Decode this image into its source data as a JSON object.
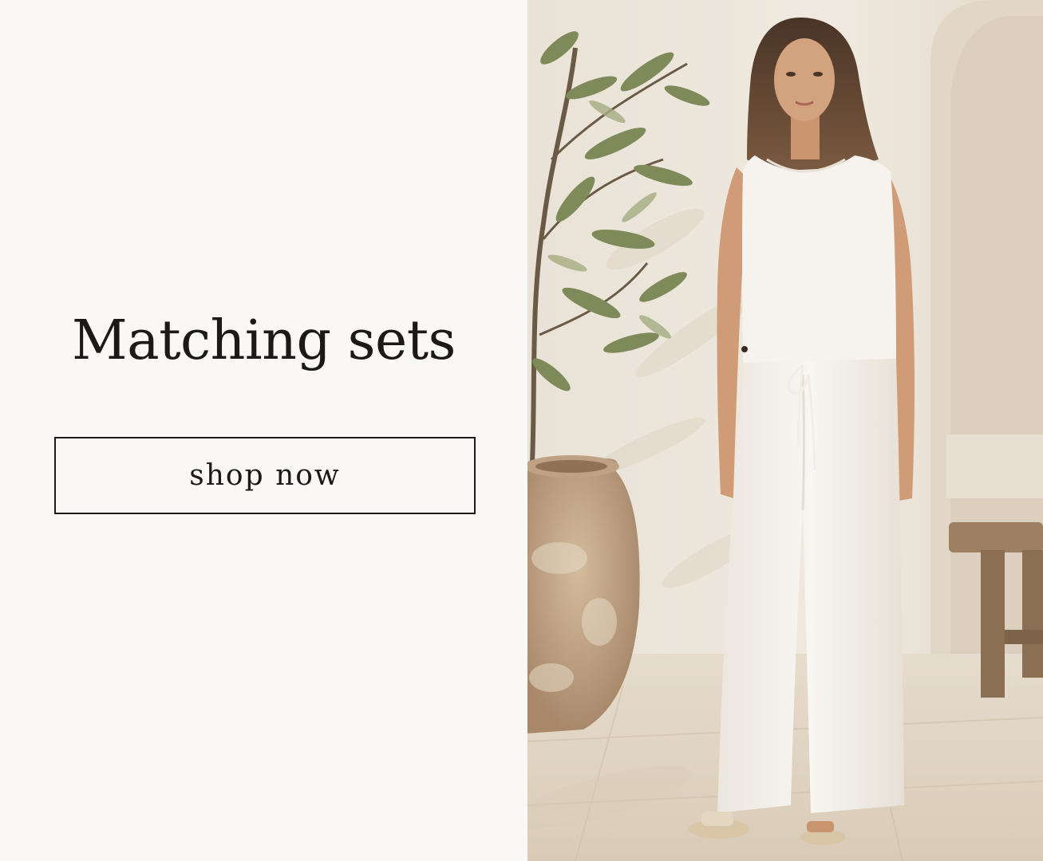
{
  "hero": {
    "headline": "Matching sets",
    "cta_label": "shop now"
  },
  "image": {
    "alt": "Model wearing white sleeveless top and wide-leg pants set beside an olive tree in a terracotta pot"
  },
  "colors": {
    "background": "#f9f8f6",
    "text": "#1c1a18",
    "wall": "#ece6dc",
    "floor": "#e3d8c8",
    "pot": "#c9ae8e",
    "skin": "#d3a27e",
    "garment": "#f6f3ee"
  }
}
